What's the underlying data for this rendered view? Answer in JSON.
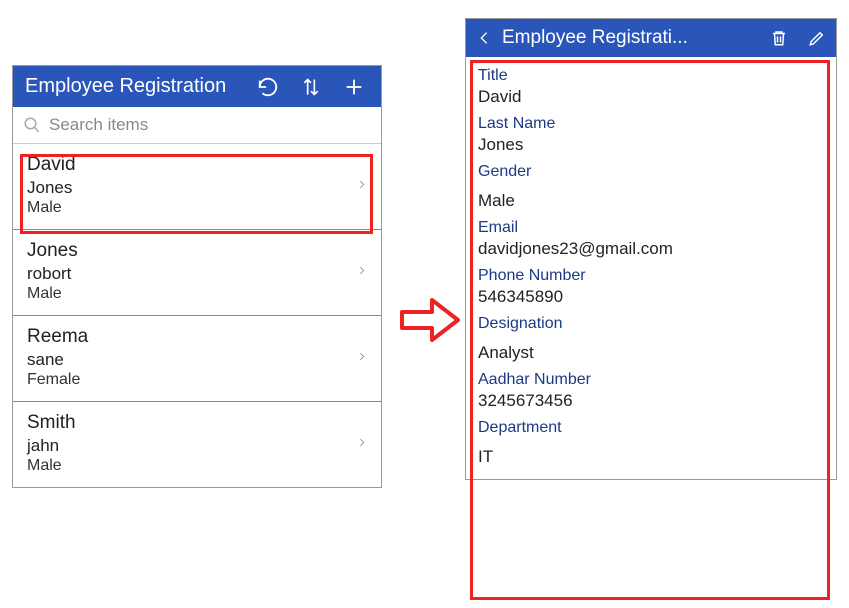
{
  "list": {
    "title": "Employee Registration",
    "search_placeholder": "Search items",
    "items": [
      {
        "line1": "David",
        "line2": "Jones",
        "line3": "Male"
      },
      {
        "line1": "Jones",
        "line2": "robort",
        "line3": "Male"
      },
      {
        "line1": "Reema",
        "line2": "sane",
        "line3": "Female"
      },
      {
        "line1": "Smith",
        "line2": "jahn",
        "line3": "Male"
      }
    ]
  },
  "detail": {
    "title": "Employee Registrati...",
    "fields": {
      "title_label": "Title",
      "title_value": "David",
      "lastname_label": "Last Name",
      "lastname_value": "Jones",
      "gender_label": "Gender",
      "gender_value": "Male",
      "email_label": "Email",
      "email_value": "davidjones23@gmail.com",
      "phone_label": "Phone Number",
      "phone_value": "546345890",
      "designation_label": "Designation",
      "designation_value": "Analyst",
      "aadhar_label": "Aadhar Number",
      "aadhar_value": "3245673456",
      "dept_label": "Department",
      "dept_value": "IT"
    }
  }
}
